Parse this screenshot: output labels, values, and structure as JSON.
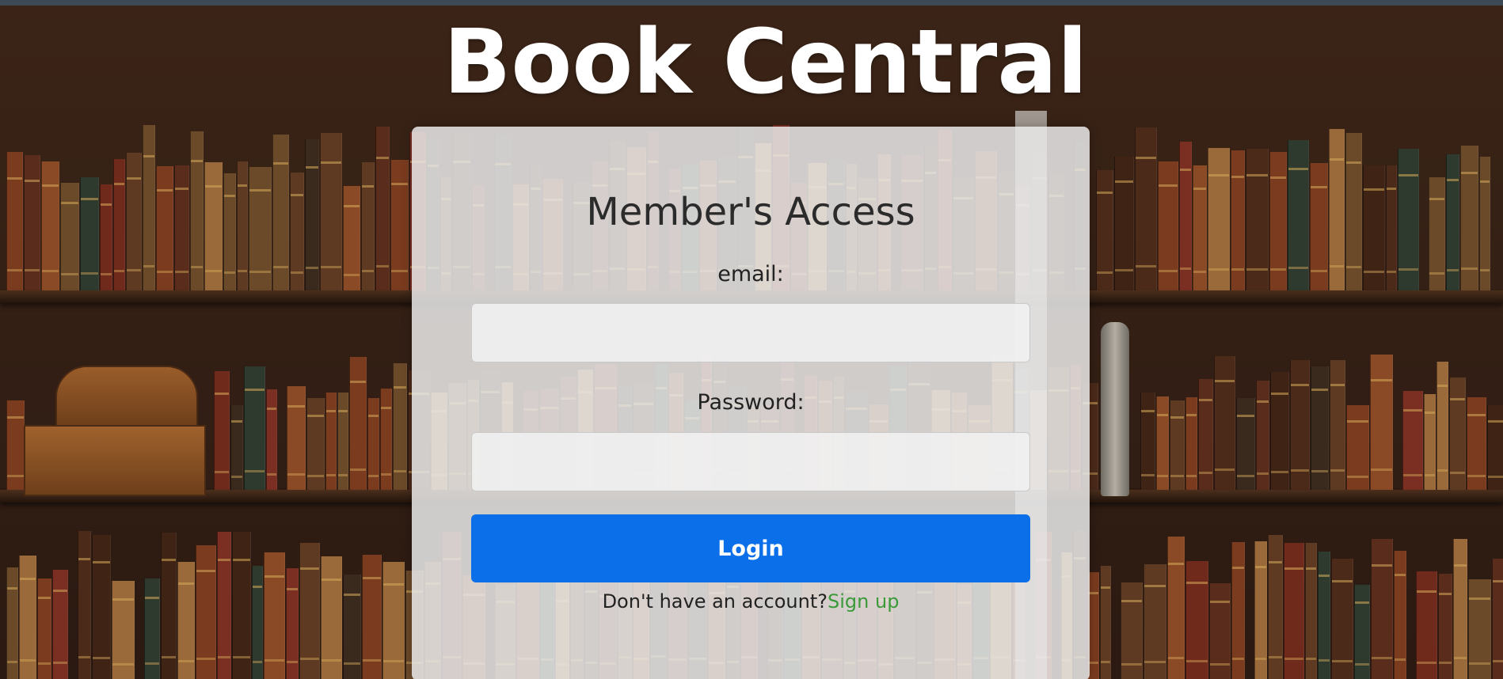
{
  "page": {
    "site_title": "Book Central"
  },
  "login_form": {
    "heading": "Member's Access",
    "email_label": "email:",
    "email_value": "",
    "password_label": "Password:",
    "password_value": "",
    "login_button_label": "Login",
    "signup_prompt": "Don't have an account?",
    "signup_link_label": "Sign up"
  },
  "colors": {
    "primary_button": "#0a6fe8",
    "signup_link": "#3a9a3a",
    "title_text": "#ffffff"
  }
}
